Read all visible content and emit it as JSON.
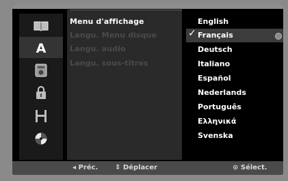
{
  "icons": [
    "disc-icon",
    "language-a-icon",
    "audio-icon",
    "lock-icon",
    "recording-icon",
    "other-icon"
  ],
  "menu": {
    "items": [
      {
        "label": "Menu d'affichage",
        "active": true
      },
      {
        "label": "Langu. Menu disque",
        "active": false
      },
      {
        "label": "Langu. audio",
        "active": false
      },
      {
        "label": "Langu. sous-titres",
        "active": false
      }
    ]
  },
  "languages": {
    "options": [
      "English",
      "Français",
      "Deutsch",
      "Italiano",
      "Español",
      "Nederlands",
      "Português",
      "Ελληνικά",
      "Svenska"
    ],
    "selected": "Français",
    "check_symbol": "✓"
  },
  "bottom": {
    "prev": "◂ Préc.",
    "move": "⇕ Déplacer",
    "select": "⊙ Sélect."
  },
  "colors": {
    "background": "#000000",
    "panel": "#2a2a2a",
    "highlight": "#4a4a4a",
    "text": "#ffffff",
    "dim_text": "#4b4b4b"
  }
}
